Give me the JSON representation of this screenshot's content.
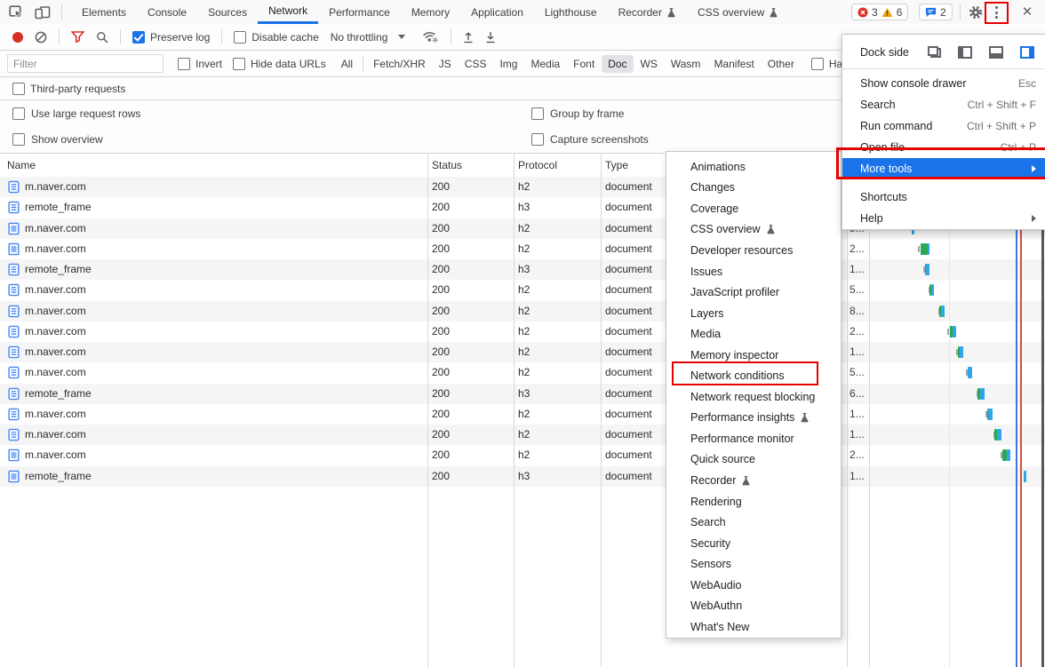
{
  "tabbar": {
    "tabs": [
      {
        "label": "Elements"
      },
      {
        "label": "Console"
      },
      {
        "label": "Sources"
      },
      {
        "label": "Network",
        "active": true
      },
      {
        "label": "Performance"
      },
      {
        "label": "Memory"
      },
      {
        "label": "Application"
      },
      {
        "label": "Lighthouse"
      },
      {
        "label": "Recorder",
        "flask": true
      },
      {
        "label": "CSS overview",
        "flask": true
      }
    ],
    "badges": {
      "errors": "3",
      "warnings": "6",
      "messages": "2"
    }
  },
  "toolbar": {
    "preserve_log": "Preserve log",
    "disable_cache": "Disable cache",
    "throttling": "No throttling"
  },
  "filter_bar": {
    "placeholder": "Filter",
    "invert": "Invert",
    "hide_data_urls": "Hide data URLs",
    "all": "All",
    "chips": [
      "Fetch/XHR",
      "JS",
      "CSS",
      "Img",
      "Media",
      "Font",
      "Doc",
      "WS",
      "Wasm",
      "Manifest",
      "Other"
    ],
    "active_chip": "Doc",
    "has_blocked": "Has blo"
  },
  "options": {
    "third_party": "Third-party requests",
    "large_rows": "Use large request rows",
    "group_by_frame": "Group by frame",
    "show_overview": "Show overview",
    "capture_screenshots": "Capture screenshots"
  },
  "table": {
    "headers": {
      "name": "Name",
      "status": "Status",
      "protocol": "Protocol",
      "type": "Type"
    },
    "rows": [
      {
        "name": "m.naver.com",
        "icon": "document",
        "status": "200",
        "protocol": "h2",
        "type": "document",
        "time": null,
        "bar": null
      },
      {
        "name": "remote_frame",
        "icon": "document",
        "status": "200",
        "protocol": "h3",
        "type": "document",
        "time": null,
        "bar": null
      },
      {
        "name": "m.naver.com",
        "icon": "frame",
        "status": "200",
        "protocol": "h2",
        "type": "document",
        "time": "9...",
        "bar": {
          "blue": [
            1026,
            1029
          ]
        }
      },
      {
        "name": "m.naver.com",
        "icon": "frame",
        "status": "200",
        "protocol": "h2",
        "type": "document",
        "time": "2...",
        "bar": {
          "tick": 1033,
          "green": [
            1036,
            1044
          ],
          "blue": [
            1044,
            1046
          ]
        }
      },
      {
        "name": "remote_frame",
        "icon": "document",
        "status": "200",
        "protocol": "h3",
        "type": "document",
        "time": "1...",
        "bar": {
          "tick": 1039,
          "green": [
            1041,
            1042
          ],
          "blue": [
            1042,
            1046
          ]
        }
      },
      {
        "name": "m.naver.com",
        "icon": "document",
        "status": "200",
        "protocol": "h2",
        "type": "document",
        "time": "5...",
        "bar": {
          "tick": 1045,
          "green": [
            1046,
            1048
          ],
          "blue": [
            1048,
            1051
          ]
        }
      },
      {
        "name": "m.naver.com",
        "icon": "document",
        "status": "200",
        "protocol": "h2",
        "type": "document",
        "time": "8...",
        "bar": {
          "tick": 1056,
          "green": [
            1057,
            1059
          ],
          "blue": [
            1059,
            1063
          ]
        }
      },
      {
        "name": "m.naver.com",
        "icon": "document",
        "status": "200",
        "protocol": "h2",
        "type": "document",
        "time": "2...",
        "bar": {
          "tick": 1066,
          "green": [
            1068,
            1072
          ],
          "blue": [
            1072,
            1076
          ]
        }
      },
      {
        "name": "m.naver.com",
        "icon": "document",
        "status": "200",
        "protocol": "h2",
        "type": "document",
        "time": "1...",
        "bar": {
          "tick": 1076,
          "green": [
            1078,
            1080
          ],
          "blue": [
            1080,
            1084
          ]
        }
      },
      {
        "name": "m.naver.com",
        "icon": "document",
        "status": "200",
        "protocol": "h2",
        "type": "document",
        "time": "5...",
        "bar": {
          "tick": 1087,
          "blue": [
            1089,
            1094
          ]
        }
      },
      {
        "name": "remote_frame",
        "icon": "document",
        "status": "200",
        "protocol": "h3",
        "type": "document",
        "time": "6...",
        "bar": {
          "tick": 1099,
          "green": [
            1100,
            1103
          ],
          "blue": [
            1103,
            1108
          ]
        }
      },
      {
        "name": "m.naver.com",
        "icon": "document",
        "status": "200",
        "protocol": "h2",
        "type": "document",
        "time": "1...",
        "bar": {
          "tick": 1109,
          "green": [
            1111,
            1112
          ],
          "blue": [
            1112,
            1117
          ]
        }
      },
      {
        "name": "m.naver.com",
        "icon": "document",
        "status": "200",
        "protocol": "h2",
        "type": "document",
        "time": "1...",
        "bar": {
          "tick": 1118,
          "green": [
            1119,
            1122
          ],
          "blue": [
            1122,
            1127
          ]
        }
      },
      {
        "name": "m.naver.com",
        "icon": "frame",
        "status": "200",
        "protocol": "h2",
        "type": "document",
        "time": "2...",
        "bar": {
          "tick": 1126,
          "green": [
            1128,
            1133
          ],
          "blue": [
            1133,
            1137
          ]
        }
      },
      {
        "name": "remote_frame",
        "icon": "frame",
        "status": "200",
        "protocol": "h3",
        "type": "document",
        "time": "1...",
        "bar": {
          "blue": [
            1152,
            1155
          ]
        }
      }
    ]
  },
  "waterfall": {
    "green": "#2aa952",
    "blue": "#2da6ea"
  },
  "main_menu": {
    "dock_side_label": "Dock side",
    "items": [
      {
        "label": "Show console drawer",
        "shortcut": "Esc"
      },
      {
        "label": "Search",
        "shortcut": "Ctrl + Shift + F"
      },
      {
        "label": "Run command",
        "shortcut": "Ctrl + Shift + P"
      },
      {
        "label": "Open file",
        "shortcut": "Ctrl + P"
      },
      {
        "label": "More tools",
        "submenu": true,
        "active": true
      },
      {
        "label": "Shortcuts",
        "gap_before": true
      },
      {
        "label": "Help",
        "submenu": true
      }
    ]
  },
  "submenu": {
    "items": [
      {
        "label": "Animations"
      },
      {
        "label": "Changes"
      },
      {
        "label": "Coverage"
      },
      {
        "label": "CSS overview",
        "flask": true
      },
      {
        "label": "Developer resources"
      },
      {
        "label": "Issues"
      },
      {
        "label": "JavaScript profiler"
      },
      {
        "label": "Layers"
      },
      {
        "label": "Media"
      },
      {
        "label": "Memory inspector"
      },
      {
        "label": "Network conditions",
        "red_box": true
      },
      {
        "label": "Network request blocking"
      },
      {
        "label": "Performance insights",
        "flask": true
      },
      {
        "label": "Performance monitor"
      },
      {
        "label": "Quick source"
      },
      {
        "label": "Recorder",
        "flask": true
      },
      {
        "label": "Rendering"
      },
      {
        "label": "Search"
      },
      {
        "label": "Security"
      },
      {
        "label": "Sensors"
      },
      {
        "label": "WebAudio"
      },
      {
        "label": "WebAuthn"
      },
      {
        "label": "What's New"
      }
    ]
  },
  "colors": {
    "accent": "#1a73e8",
    "annotation_red": "#e60000",
    "error_red": "#d93025",
    "warning_yellow": "#f2a60d"
  }
}
